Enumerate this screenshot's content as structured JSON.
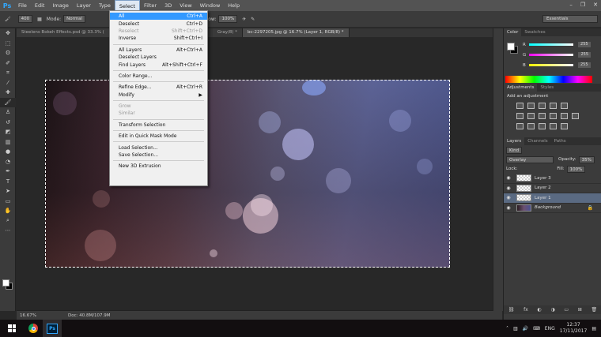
{
  "app": {
    "logo": "Ps",
    "window_controls": [
      "–",
      "❐",
      "✕"
    ]
  },
  "menubar": {
    "items": [
      "File",
      "Edit",
      "Image",
      "Layer",
      "Type",
      "Select",
      "Filter",
      "3D",
      "View",
      "Window",
      "Help"
    ],
    "active": "Select"
  },
  "options": {
    "brush_size": "400",
    "mode_label": "Mode:",
    "mode_value": "Normal",
    "flow_label": "Flow:",
    "flow_value": "100%",
    "workspace": "Essentials"
  },
  "tabs": [
    {
      "label": "Steelens Bokeh Effects.psd @ 33.3% (",
      "active": false
    },
    {
      "label": "Gray/8) *",
      "active": false
    },
    {
      "label": "bc-2297205.jpg @ 16.7% (Layer 1, RGB/8) *",
      "active": true
    }
  ],
  "select_menu": [
    {
      "label": "All",
      "shortcut": "Ctrl+A",
      "state": "highlighted"
    },
    {
      "label": "Deselect",
      "shortcut": "Ctrl+D"
    },
    {
      "label": "Reselect",
      "shortcut": "Shift+Ctrl+D",
      "state": "disabled"
    },
    {
      "label": "Inverse",
      "shortcut": "Shift+Ctrl+I"
    },
    {
      "sep": true
    },
    {
      "label": "All Layers",
      "shortcut": "Alt+Ctrl+A"
    },
    {
      "label": "Deselect Layers",
      "shortcut": ""
    },
    {
      "label": "Find Layers",
      "shortcut": "Alt+Shift+Ctrl+F"
    },
    {
      "sep": true
    },
    {
      "label": "Color Range...",
      "shortcut": ""
    },
    {
      "sep": true
    },
    {
      "label": "Refine Edge...",
      "shortcut": "Alt+Ctrl+R"
    },
    {
      "label": "Modify",
      "shortcut": "▶"
    },
    {
      "sep": true
    },
    {
      "label": "Grow",
      "shortcut": "",
      "state": "disabled"
    },
    {
      "label": "Similar",
      "shortcut": "",
      "state": "disabled"
    },
    {
      "sep": true
    },
    {
      "label": "Transform Selection",
      "shortcut": ""
    },
    {
      "sep": true
    },
    {
      "label": "Edit in Quick Mask Mode",
      "shortcut": ""
    },
    {
      "sep": true
    },
    {
      "label": "Load Selection...",
      "shortcut": ""
    },
    {
      "label": "Save Selection...",
      "shortcut": ""
    },
    {
      "sep": true
    },
    {
      "label": "New 3D Extrusion",
      "shortcut": ""
    }
  ],
  "status": {
    "zoom": "16.67%",
    "doc": "Doc: 40.8M/107.9M"
  },
  "color_panel": {
    "tabs": [
      "Color",
      "Swatches"
    ],
    "channels": [
      {
        "name": "R",
        "value": "255",
        "color": "#ff4040"
      },
      {
        "name": "G",
        "value": "255",
        "color": "#40ff40"
      },
      {
        "name": "B",
        "value": "255",
        "color": "#4080ff"
      }
    ]
  },
  "adjustments_panel": {
    "tabs": [
      "Adjustments",
      "Styles"
    ],
    "title": "Add an adjustment"
  },
  "layers_panel": {
    "tabs": [
      "Layers",
      "Channels",
      "Paths"
    ],
    "filter_kind": "Kind",
    "blend_mode": "Overlay",
    "opacity_label": "Opacity:",
    "opacity_value": "35%",
    "lock_label": "Lock:",
    "fill_label": "Fill:",
    "fill_value": "100%",
    "layers": [
      {
        "name": "Layer 3",
        "selected": false,
        "bg": false
      },
      {
        "name": "Layer 2",
        "selected": false,
        "bg": false
      },
      {
        "name": "Layer 1",
        "selected": true,
        "bg": false
      },
      {
        "name": "Background",
        "selected": false,
        "bg": true
      }
    ]
  },
  "taskbar": {
    "language": "ENG",
    "time": "12:37",
    "date": "17/11/2017"
  }
}
